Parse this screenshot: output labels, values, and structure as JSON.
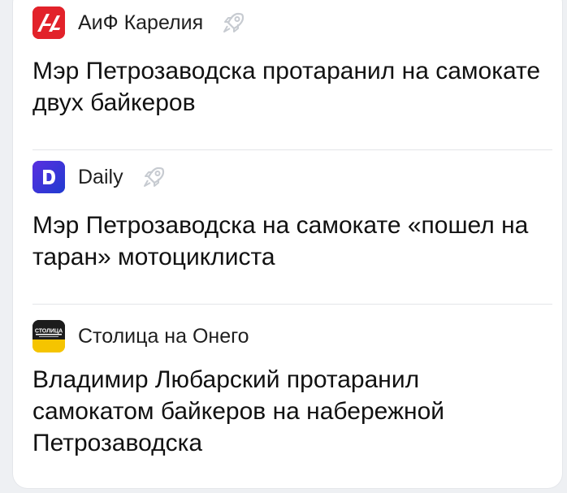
{
  "feed": {
    "items": [
      {
        "source_name": "АиФ Карелия",
        "source_logo": "aif-logo-icon",
        "logo_text": "АиФ",
        "has_rocket": true,
        "headline": "Мэр Петрозаводска протаранил на самокате двух байкеров"
      },
      {
        "source_name": "Daily",
        "source_logo": "daily-logo-icon",
        "logo_text": "D",
        "has_rocket": true,
        "headline": "Мэр Петрозаводска на самокате «пошел на таран» мотоциклиста"
      },
      {
        "source_name": "Столица на Онего",
        "source_logo": "stolitsa-logo-icon",
        "logo_text": "СТОЛИЦА",
        "has_rocket": false,
        "headline": "Владимир Любарский протаранил самокатом байкеров на набережной Петрозаводска"
      }
    ]
  },
  "colors": {
    "aif_red": "#e2222a",
    "daily_blue": "#3a2fd0",
    "stolitsa_yellow": "#f5c400",
    "rocket_gray": "#c7cbd1"
  }
}
